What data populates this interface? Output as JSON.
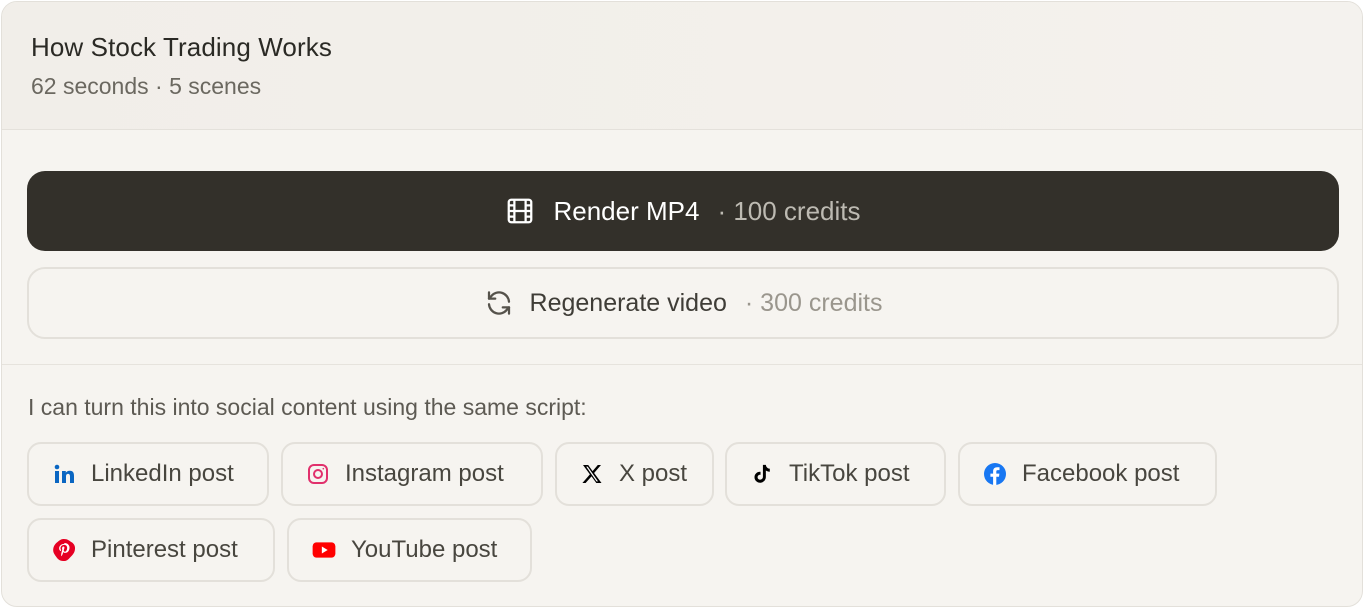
{
  "header": {
    "title": "How Stock Trading Works",
    "subtitle": "62 seconds · 5 scenes"
  },
  "actions": {
    "render": {
      "label": "Render MP4",
      "cost": "· 100 credits",
      "icon": "film-icon"
    },
    "regenerate": {
      "label": "Regenerate video",
      "cost": "· 300 credits",
      "icon": "refresh-icon"
    }
  },
  "social": {
    "prompt": "I can turn this into social content using the same script:",
    "chips": [
      {
        "label": "LinkedIn post",
        "icon": "linkedin-icon",
        "color": "#0a66c2"
      },
      {
        "label": "Instagram post",
        "icon": "instagram-icon",
        "color": "#e1306c"
      },
      {
        "label": "X post",
        "icon": "x-icon",
        "color": "#000000"
      },
      {
        "label": "TikTok post",
        "icon": "tiktok-icon",
        "color": "#000000"
      },
      {
        "label": "Facebook post",
        "icon": "facebook-icon",
        "color": "#1877f2"
      },
      {
        "label": "Pinterest post",
        "icon": "pinterest-icon",
        "color": "#e60023"
      },
      {
        "label": "YouTube post",
        "icon": "youtube-icon",
        "color": "#ff0000"
      }
    ]
  },
  "colors": {
    "primary_button": "#33302a",
    "background": "#f6f4f0",
    "border": "#e3e0da"
  }
}
